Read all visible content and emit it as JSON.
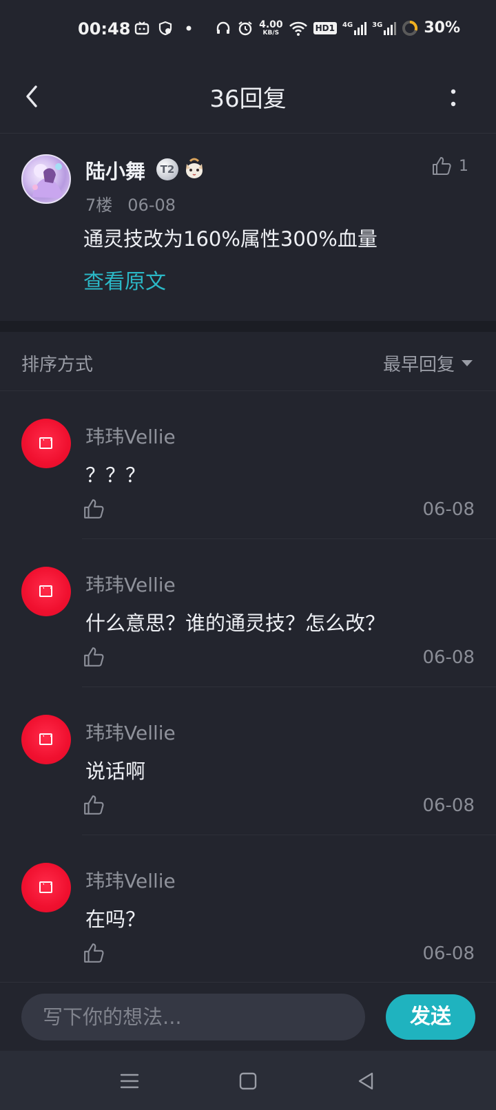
{
  "status_bar": {
    "time": "00:48",
    "network_speed_value": "4.00",
    "network_speed_unit": "KB/S",
    "hd_label": "HD1",
    "signal1_label": "4G",
    "signal2_label": "3G",
    "battery": "30%"
  },
  "header": {
    "title": "36回复"
  },
  "post": {
    "author": "陆小舞",
    "badge_label": "T2",
    "like_count": "1",
    "floor": "7楼",
    "date": "06-08",
    "text": "通灵技改为160%属性300%血量",
    "view_original": "查看原文"
  },
  "sort": {
    "label": "排序方式",
    "selected": "最早回复"
  },
  "replies": [
    {
      "name": "玮玮Vellie",
      "text": "？？？",
      "date": "06-08"
    },
    {
      "name": "玮玮Vellie",
      "text": "什么意思？谁的通灵技？怎么改？",
      "date": "06-08"
    },
    {
      "name": "玮玮Vellie",
      "text": "说话啊",
      "date": "06-08"
    },
    {
      "name": "玮玮Vellie",
      "text": "在吗？",
      "date": "06-08"
    }
  ],
  "composer": {
    "placeholder": "写下你的想法...",
    "send_label": "发送"
  },
  "colors": {
    "background": "#23252e",
    "accent": "#1fb3bf",
    "link": "#2bb8c6",
    "avatar_red": "#f0102f"
  },
  "icons": {
    "back": "chevron-left-icon",
    "more": "more-vertical-icon",
    "like": "thumb-up-icon",
    "sort_caret": "caret-down-icon",
    "nav_menu": "menu-icon",
    "nav_home": "square-home-icon",
    "nav_back": "triangle-back-icon"
  }
}
